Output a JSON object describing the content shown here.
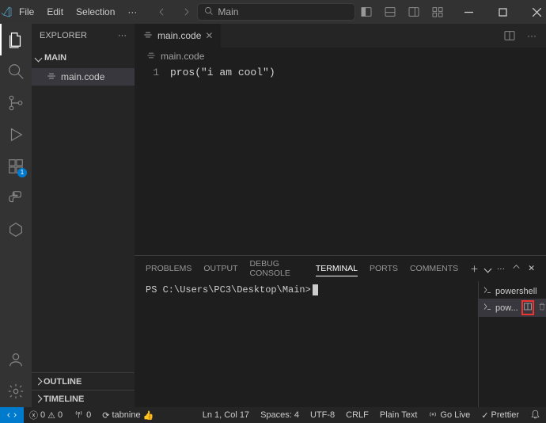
{
  "titlebar": {
    "menu": {
      "file": "File",
      "edit": "Edit",
      "selection": "Selection",
      "more": "···"
    },
    "search_text": "Main"
  },
  "explorer": {
    "title": "EXPLORER",
    "more": "···",
    "folder": "MAIN",
    "files": [
      "main.code"
    ],
    "outline": "OUTLINE",
    "timeline": "TIMELINE"
  },
  "activity": {
    "ext_badge": "1"
  },
  "editor": {
    "tab_file": "main.code",
    "breadcrumb": "main.code",
    "line_no": "1",
    "code": "pros(\"i am cool\")"
  },
  "panel": {
    "tabs": {
      "problems": "PROBLEMS",
      "output": "OUTPUT",
      "debug": "DEBUG CONSOLE",
      "terminal": "TERMINAL",
      "ports": "PORTS",
      "comments": "COMMENTS"
    },
    "prompt": "PS C:\\Users\\PC3\\Desktop\\Main>",
    "terminals": {
      "t1": "powershell",
      "t2": "pow..."
    }
  },
  "status": {
    "errors": "0",
    "warnings": "0",
    "ports": "0",
    "tabnine": "tabnine",
    "cursor": "Ln 1, Col 17",
    "spaces": "Spaces: 4",
    "encoding": "UTF-8",
    "eol": "CRLF",
    "lang": "Plain Text",
    "golive": "Go Live",
    "prettier": "Prettier"
  }
}
